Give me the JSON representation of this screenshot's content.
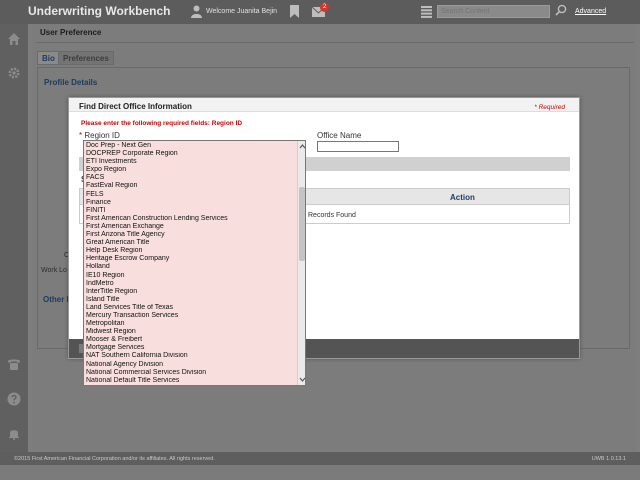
{
  "header": {
    "app_title": "Underwriting Workbench",
    "welcome": "Welcome Juanita Bejin",
    "mail_count": "2",
    "search_placeholder": "Search Content",
    "advanced": "Advanced"
  },
  "page": {
    "title": "User Preference",
    "tabs": [
      {
        "label": "Bio",
        "active": true
      },
      {
        "label": "Preferences",
        "active": false
      }
    ],
    "section_profile": "Profile Details",
    "ghost_labels": [
      "Co",
      "Work Lo",
      "Other D"
    ]
  },
  "dialog": {
    "title": "Find Direct Office Information",
    "required_note": "* Required",
    "error": "Please enter the following required fields: Region ID",
    "region_label": "Region ID",
    "region_required_mark": "*",
    "office_label": "Office Name",
    "section_stub": "S",
    "action_header": "Action",
    "no_records": "Records Found"
  },
  "region_options": [
    "Doc Prep - Next Gen",
    "DOCPREP Corporate Region",
    "ETI Investments",
    "Expo Region",
    "FACS",
    "FastEval Region",
    "FELS",
    "Finance",
    "FINITI",
    "First American Construction Lending Services",
    "First American Exchange",
    "First Arizona Title Agency",
    "Great American Title",
    "Help Desk Region",
    "Heritage Escrow Company",
    "Holland",
    "IE10 Region",
    "IndMetro",
    "InterTitle Region",
    "Island Title",
    "Land Services Title of Texas",
    "Mercury Transaction Services",
    "Metropolitan",
    "Midwest Region",
    "Mooser & Freibert",
    "Mortgage Services",
    "NAT Southern California Division",
    "National Agency Division",
    "National Commercial Services Division",
    "National Default Title Services"
  ],
  "footer": {
    "copyright": "©2015 First American Financial Corporation and/or its affiliates. All rights reserved.",
    "version": "UWB 1.0.13.1"
  }
}
